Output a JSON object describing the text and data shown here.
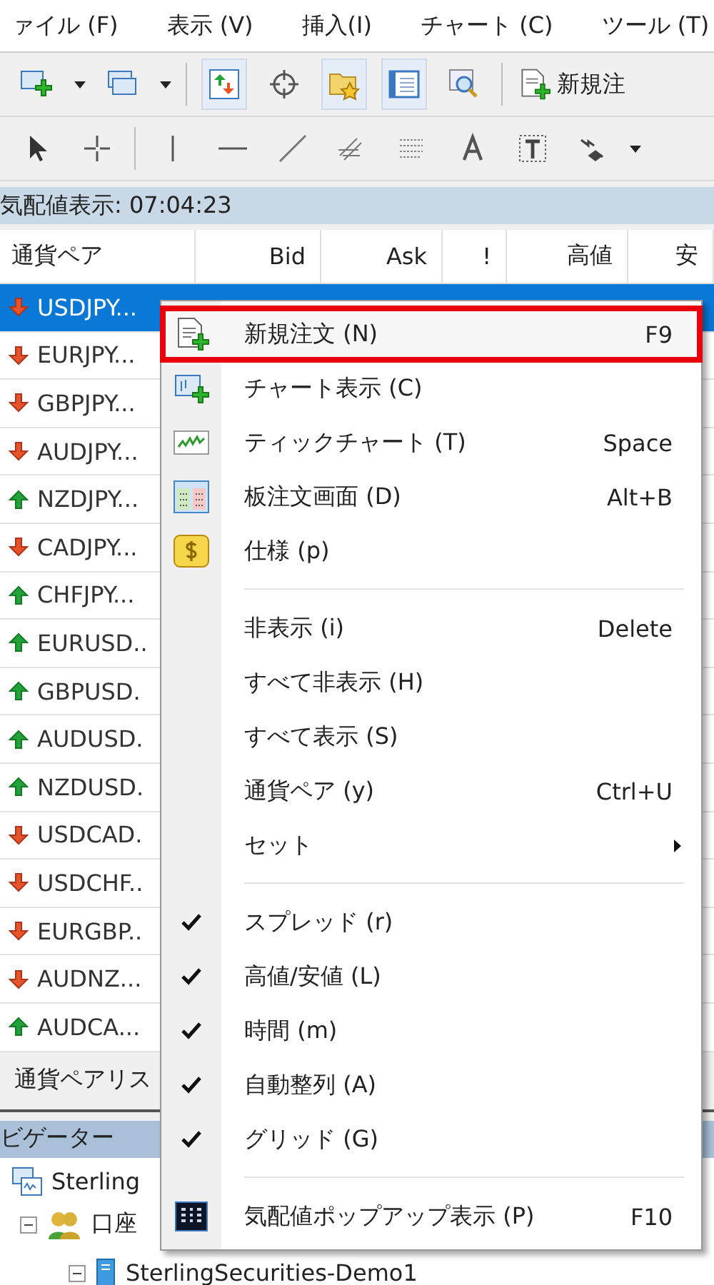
{
  "menu_bar": [
    "ァイル (F)",
    "表示 (V)",
    "挿入(I)",
    "チャート (C)",
    "ツール (T)"
  ],
  "toolbar": {
    "new_order_label": "新規注"
  },
  "market_watch": {
    "title": "気配値表示: 07:04:23",
    "columns": [
      "通貨ペア",
      "Bid",
      "Ask",
      "!",
      "高値",
      "安"
    ],
    "rows": [
      {
        "symbol": "USDJPY...",
        "rising": false,
        "selected": true
      },
      {
        "symbol": "EURJPY...",
        "rising": false,
        "selected": false
      },
      {
        "symbol": "GBPJPY...",
        "rising": false,
        "selected": false
      },
      {
        "symbol": "AUDJPY...",
        "rising": false,
        "selected": false
      },
      {
        "symbol": "NZDJPY...",
        "rising": true,
        "selected": false
      },
      {
        "symbol": "CADJPY...",
        "rising": false,
        "selected": false
      },
      {
        "symbol": "CHFJPY...",
        "rising": true,
        "selected": false
      },
      {
        "symbol": "EURUSD..",
        "rising": true,
        "selected": false
      },
      {
        "symbol": "GBPUSD.",
        "rising": true,
        "selected": false
      },
      {
        "symbol": "AUDUSD.",
        "rising": true,
        "selected": false
      },
      {
        "symbol": "NZDUSD.",
        "rising": true,
        "selected": false
      },
      {
        "symbol": "USDCAD.",
        "rising": false,
        "selected": false
      },
      {
        "symbol": "USDCHF..",
        "rising": false,
        "selected": false
      },
      {
        "symbol": "EURGBP..",
        "rising": false,
        "selected": false
      },
      {
        "symbol": "AUDNZ...",
        "rising": false,
        "selected": false
      },
      {
        "symbol": "AUDCA...",
        "rising": true,
        "selected": false
      }
    ],
    "tab": "通貨ペアリス"
  },
  "navigator": {
    "title": "ビゲーター",
    "items": [
      "Sterling",
      "口座",
      "SterlingSecurities-Demo1"
    ]
  },
  "context_menu": [
    {
      "kind": "item",
      "label": "新規注文 (N)",
      "shortcut": "F9",
      "checked": false,
      "highlighted": true
    },
    {
      "kind": "item",
      "label": "チャート表示 (C)",
      "checked": false,
      "highlighted": false
    },
    {
      "kind": "item",
      "label": "ティックチャート (T)",
      "shortcut": "Space",
      "checked": false,
      "highlighted": false
    },
    {
      "kind": "item",
      "label": "板注文画面 (D)",
      "shortcut": "Alt+B",
      "checked": false,
      "highlighted": false
    },
    {
      "kind": "item",
      "label": "仕様 (p)",
      "checked": false,
      "highlighted": false
    },
    {
      "kind": "separator"
    },
    {
      "kind": "item",
      "label": "非表示 (i)",
      "shortcut": "Delete",
      "checked": false,
      "highlighted": false
    },
    {
      "kind": "item",
      "label": "すべて非表示 (H)",
      "checked": false,
      "highlighted": false
    },
    {
      "kind": "item",
      "label": "すべて表示 (S)",
      "checked": false,
      "highlighted": false
    },
    {
      "kind": "item",
      "label": "通貨ペア (y)",
      "shortcut": "Ctrl+U",
      "checked": false,
      "highlighted": false
    },
    {
      "kind": "submenu",
      "label": "セット",
      "checked": false,
      "highlighted": false
    },
    {
      "kind": "separator"
    },
    {
      "kind": "item",
      "label": "スプレッド (r)",
      "checked": true,
      "highlighted": false
    },
    {
      "kind": "item",
      "label": "高値/安値 (L)",
      "checked": true,
      "highlighted": false
    },
    {
      "kind": "item",
      "label": "時間 (m)",
      "checked": true,
      "highlighted": false
    },
    {
      "kind": "item",
      "label": "自動整列 (A)",
      "checked": true,
      "highlighted": false
    },
    {
      "kind": "item",
      "label": "グリッド (G)",
      "checked": true,
      "highlighted": false
    },
    {
      "kind": "separator"
    },
    {
      "kind": "item",
      "label": "気配値ポップアップ表示 (P)",
      "shortcut": "F10",
      "checked": false,
      "highlighted": false
    }
  ]
}
